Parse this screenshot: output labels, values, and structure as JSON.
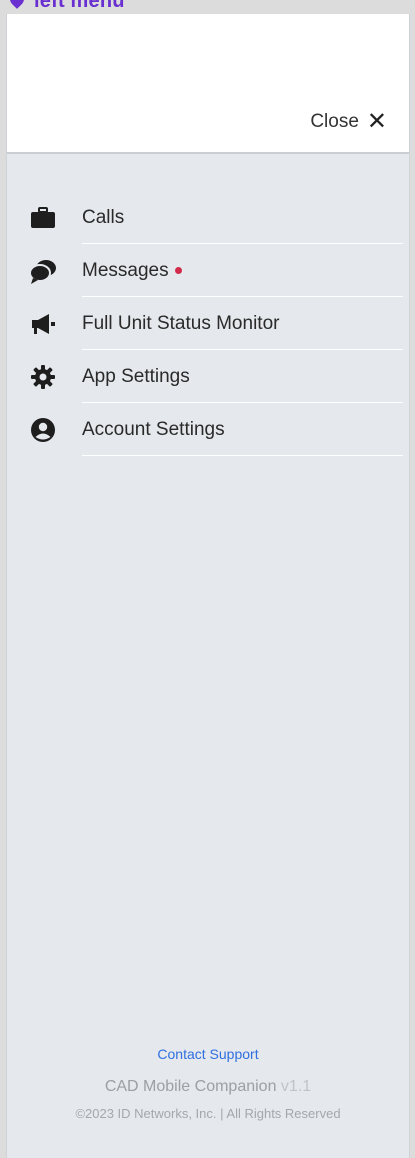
{
  "top_label": {
    "text": "left menu",
    "icon": "map-pin-icon",
    "color": "#6a2fd1"
  },
  "header": {
    "close_label": "Close",
    "close_icon": "close-icon"
  },
  "menu": {
    "items": [
      {
        "label": "Calls",
        "icon": "briefcase-icon"
      },
      {
        "label": "Messages",
        "icon": "chat-bubbles-icon",
        "has_unread_badge": true
      },
      {
        "label": "Full Unit Status Monitor",
        "icon": "megaphone-icon"
      },
      {
        "label": "App Settings",
        "icon": "gear-icon"
      },
      {
        "label": "Account Settings",
        "icon": "user-circle-icon"
      }
    ]
  },
  "footer": {
    "support_link": "Contact Support",
    "app_name": "CAD Mobile Companion",
    "version": "v1.1",
    "copyright": "©2023 ID Networks, Inc. | All Rights Reserved"
  },
  "colors": {
    "panel_bg": "#e5e8ec",
    "header_bg": "#ffffff",
    "link": "#2f6fe0",
    "badge": "#d12a4b",
    "accent": "#6a2fd1"
  }
}
